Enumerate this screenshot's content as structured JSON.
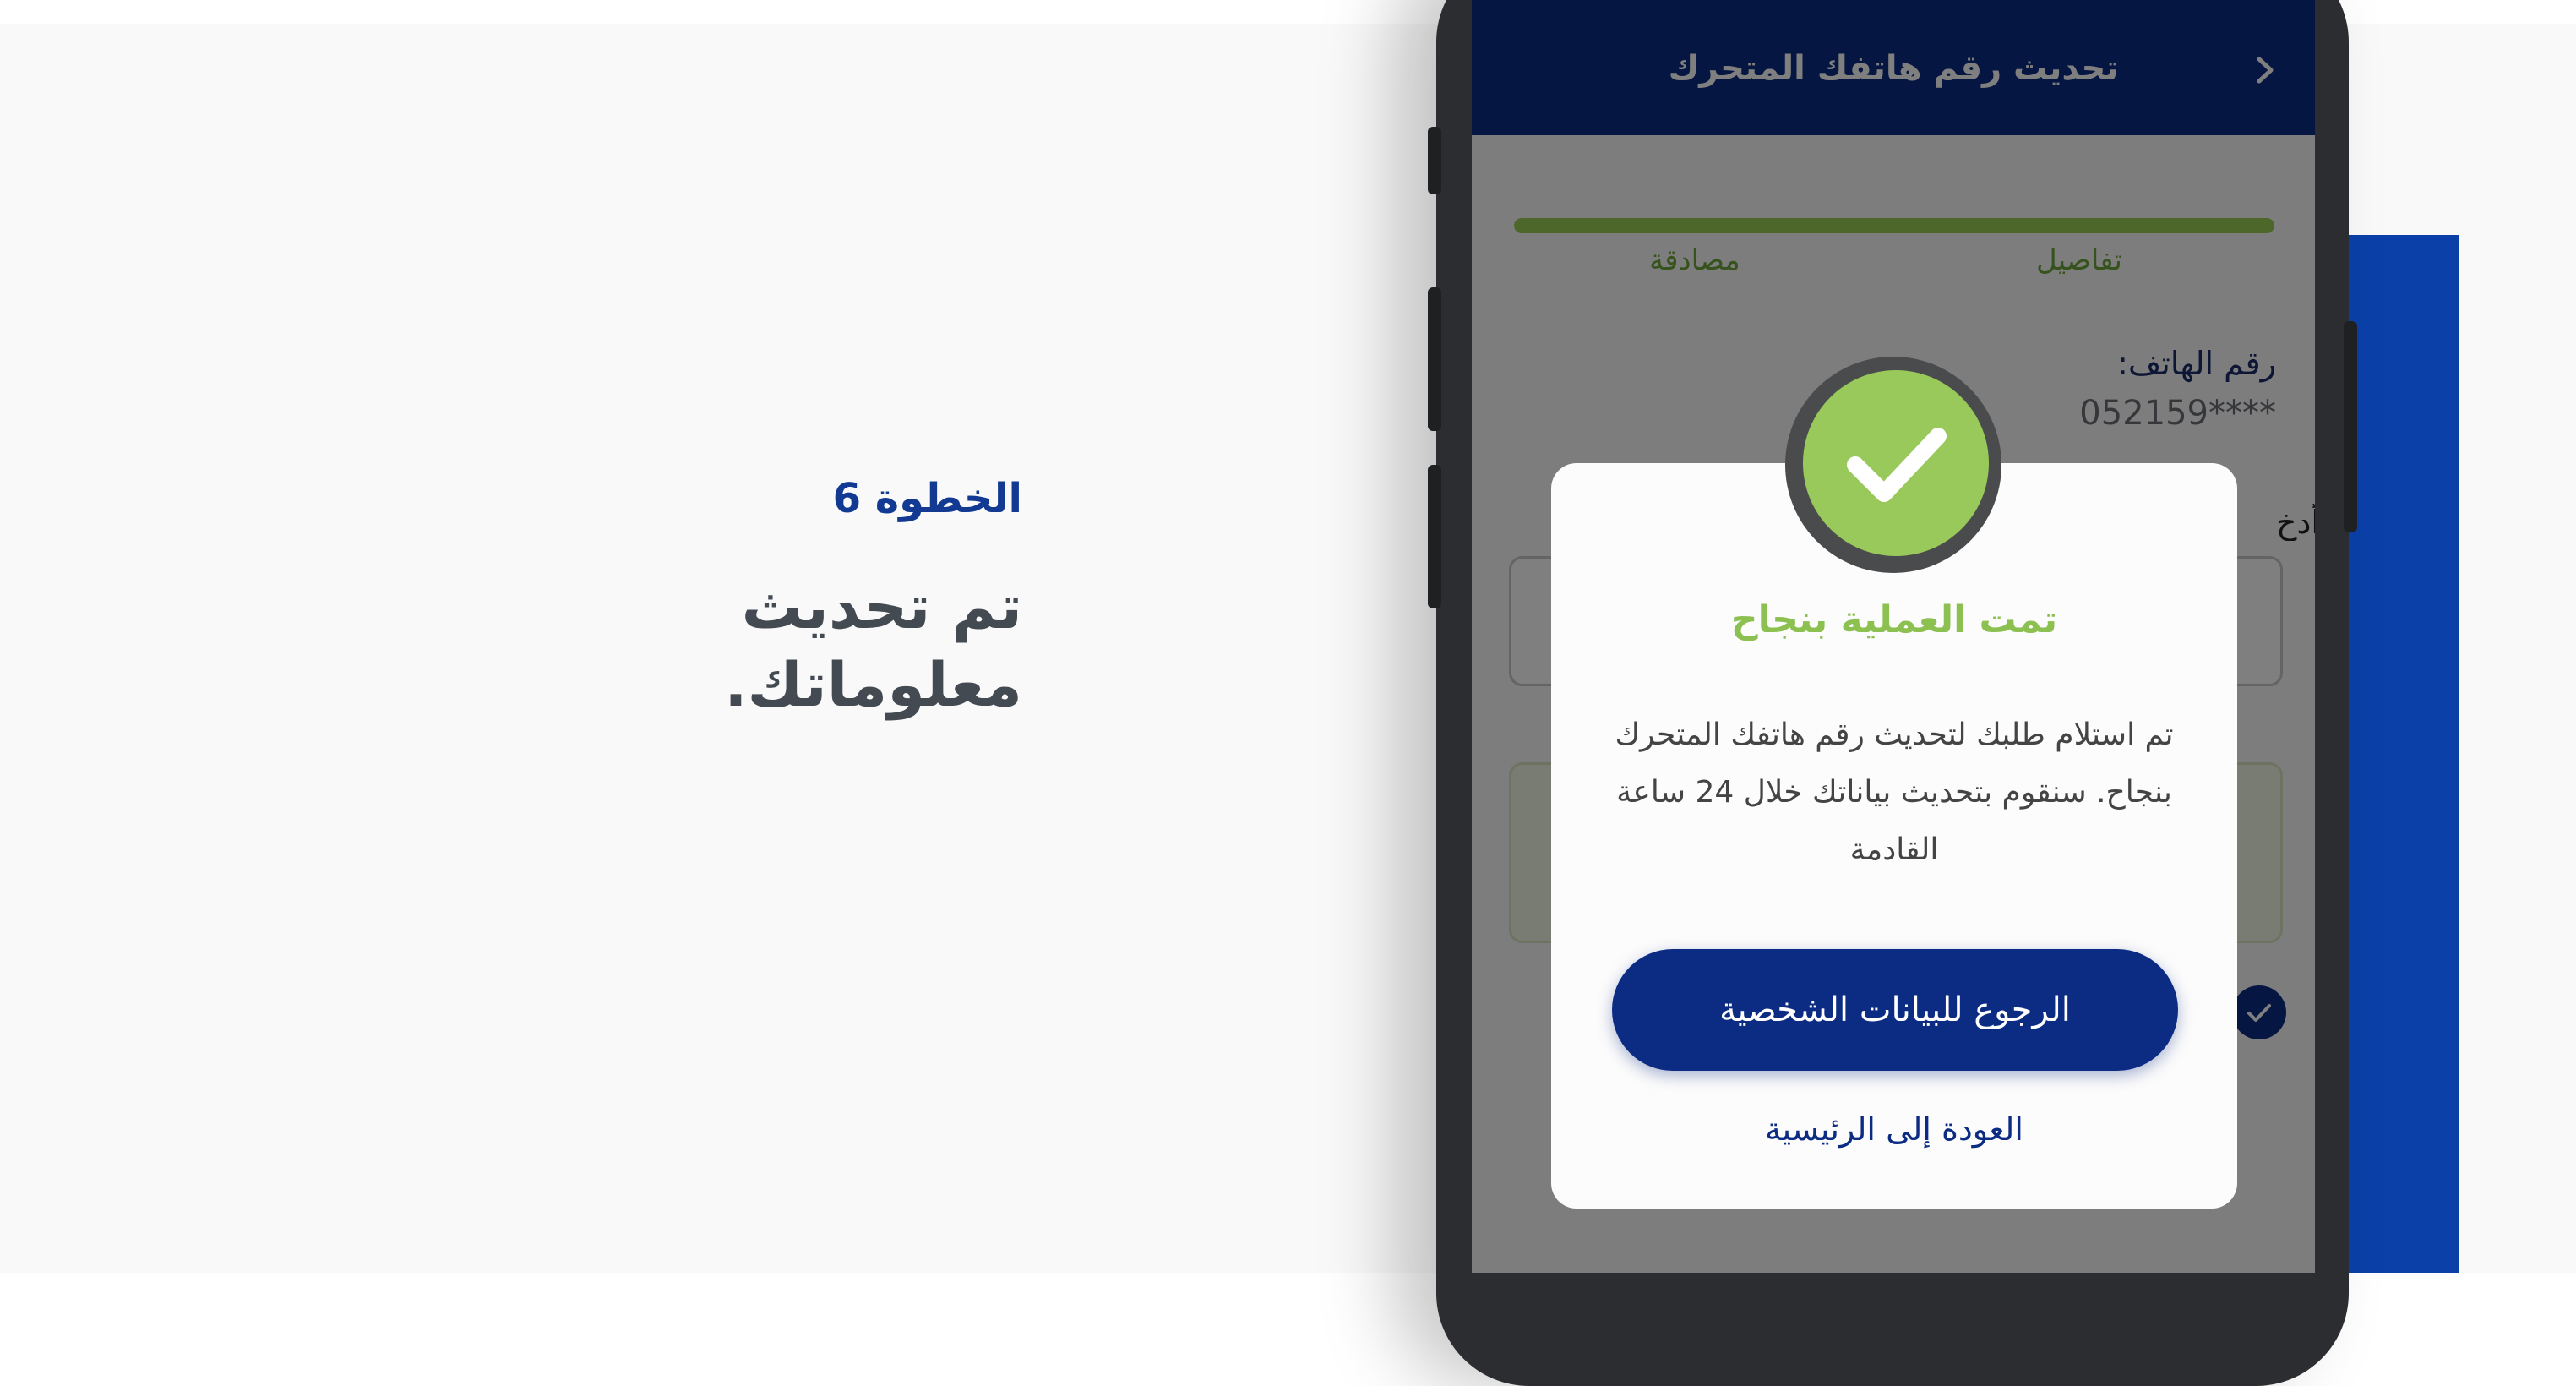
{
  "guide": {
    "step_label": "الخطوة 6",
    "step_title_line1": "تم تحديث",
    "step_title_line2": "معلوماتك."
  },
  "app": {
    "header_title": "تحديث رقم هاتفك المتحرك",
    "steps": [
      "تفاصيل",
      "مصادقة"
    ],
    "progress": 1.0,
    "phone_label": "رقم الهاتف:",
    "phone_value": "052159****",
    "enter_label": "أدخ"
  },
  "modal": {
    "title": "تمت العملية بنجاح",
    "message": "تم استلام طلبك لتحديث رقم هاتفك المتحرك بنجاح. سنقوم بتحديث بياناتك خلال 24 ساعة القادمة",
    "primary_button": "الرجوع للبيانات الشخصية",
    "secondary_link": "العودة إلى الرئيسية"
  },
  "icons": {
    "back": "chevron-right-icon",
    "success": "checkmark-icon",
    "row_check": "check-circle-icon"
  },
  "colors": {
    "brand_blue": "#0c2c84",
    "accent_blue": "#0a40a8",
    "success_green": "#98c95a"
  }
}
